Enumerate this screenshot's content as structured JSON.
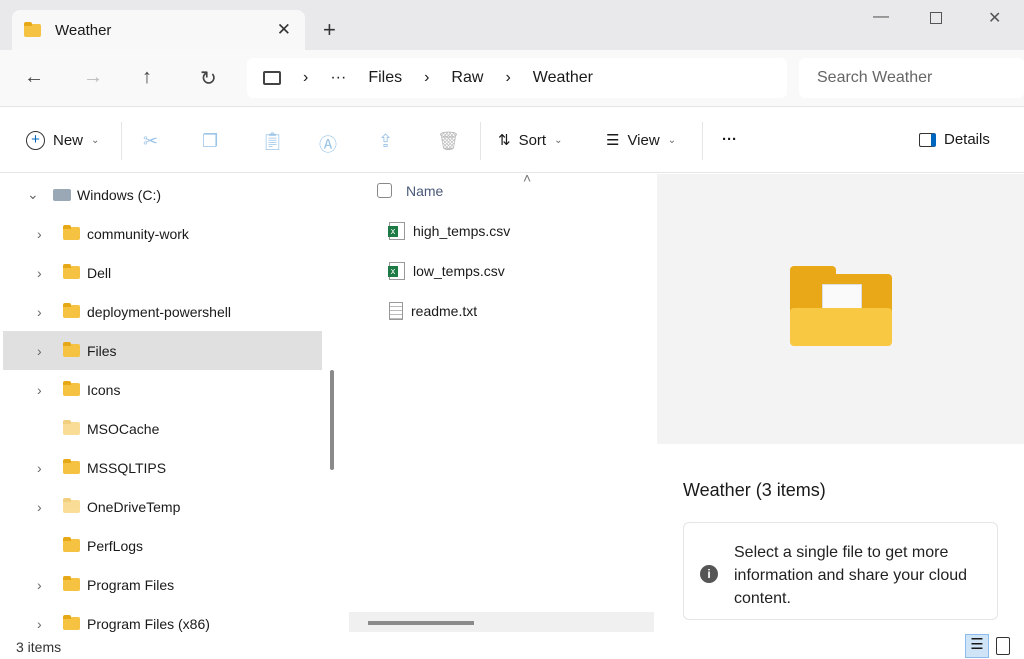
{
  "tab": {
    "title": "Weather"
  },
  "address": {
    "crumbs": [
      "Files",
      "Raw",
      "Weather"
    ],
    "ellipsis": "···",
    "search_placeholder": "Search Weather"
  },
  "toolbar": {
    "new": "New",
    "sort": "Sort",
    "view": "View",
    "more": "···",
    "details": "Details"
  },
  "tree": {
    "root": "Windows (C:)",
    "items": [
      {
        "label": "community-work",
        "chevron": true
      },
      {
        "label": "Dell",
        "chevron": true
      },
      {
        "label": "deployment-powershell",
        "chevron": true
      },
      {
        "label": "Files",
        "chevron": true,
        "selected": true
      },
      {
        "label": "Icons",
        "chevron": true
      },
      {
        "label": "MSOCache",
        "chevron": false
      },
      {
        "label": "MSSQLTIPS",
        "chevron": true
      },
      {
        "label": "OneDriveTemp",
        "chevron": true
      },
      {
        "label": "PerfLogs",
        "chevron": false
      },
      {
        "label": "Program Files",
        "chevron": true
      },
      {
        "label": "Program Files (x86)",
        "chevron": true
      }
    ]
  },
  "list": {
    "header": "Name",
    "files": [
      {
        "name": "high_temps.csv",
        "type": "csv"
      },
      {
        "name": "low_temps.csv",
        "type": "csv"
      },
      {
        "name": "readme.txt",
        "type": "txt"
      }
    ]
  },
  "preview": {
    "title": "Weather (3 items)",
    "message": "Select a single file to get more information and share your cloud content."
  },
  "status": {
    "count": "3 items"
  }
}
